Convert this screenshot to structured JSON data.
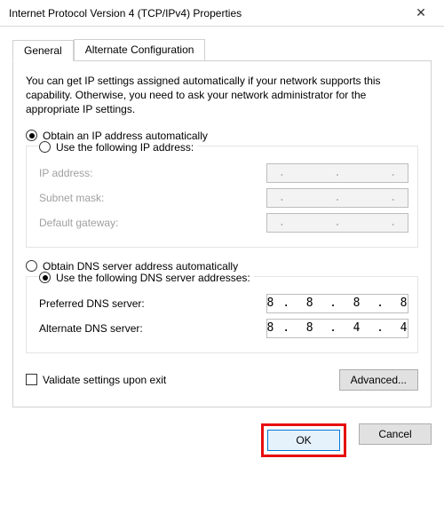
{
  "window": {
    "title": "Internet Protocol Version 4 (TCP/IPv4) Properties"
  },
  "tabs": {
    "general": "General",
    "alternate": "Alternate Configuration"
  },
  "intro": "You can get IP settings assigned automatically if your network supports this capability. Otherwise, you need to ask your network administrator for the appropriate IP settings.",
  "ip": {
    "obtainAutoLabel": "Obtain an IP address automatically",
    "obtainAutoChecked": true,
    "useFollowingLabel": "Use the following IP address:",
    "useFollowingChecked": false,
    "ipAddressLabel": "IP address:",
    "ipAddressValue": "   .       .       .   ",
    "subnetLabel": "Subnet mask:",
    "subnetValue": "   .       .       .   ",
    "gatewayLabel": "Default gateway:",
    "gatewayValue": "   .       .       .   "
  },
  "dns": {
    "obtainAutoLabel": "Obtain DNS server address automatically",
    "obtainAutoChecked": false,
    "useFollowingLabel": "Use the following DNS server addresses:",
    "useFollowingChecked": true,
    "preferredLabel": "Preferred DNS server:",
    "preferredValue": " 8 .  8  .  8  .  8 ",
    "alternateLabel": "Alternate DNS server:",
    "alternateValue": " 8 .  8  .  4  .  4 "
  },
  "validateLabel": "Validate settings upon exit",
  "validateChecked": false,
  "advancedLabel": "Advanced...",
  "buttons": {
    "ok": "OK",
    "cancel": "Cancel"
  }
}
